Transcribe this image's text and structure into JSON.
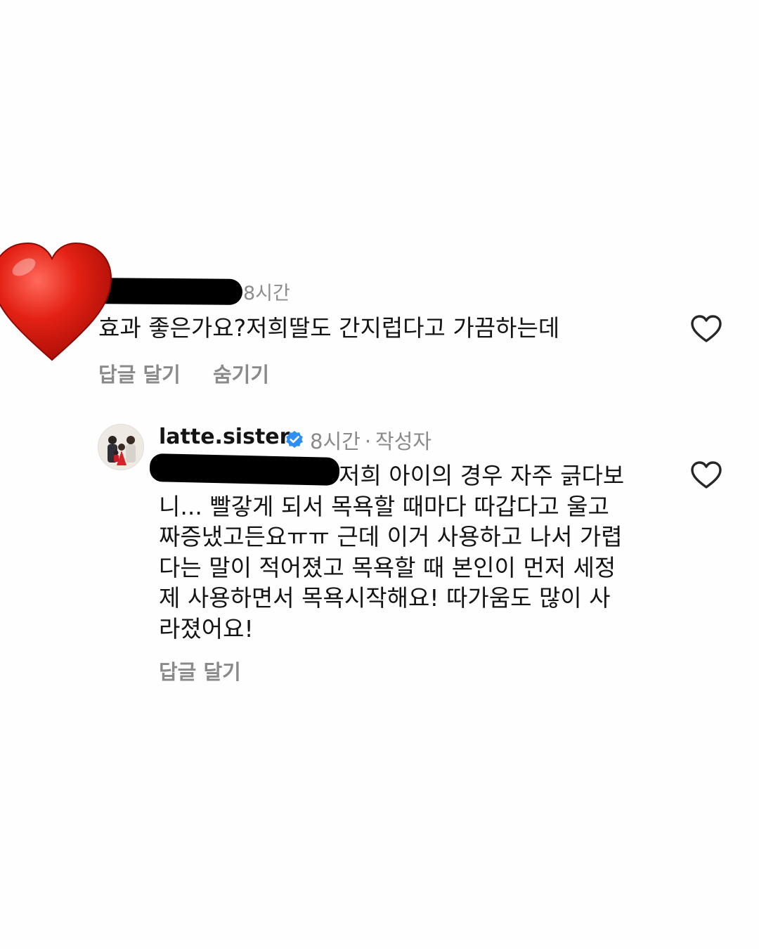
{
  "comment": {
    "time": "8시간",
    "text": "효과 좋은가요?저희딸도 간지럽다고 가끔하는데",
    "reply_label": "답글 달기",
    "hide_label": "숨기기"
  },
  "reply": {
    "username": "latte.sister",
    "time": "8시간",
    "separator": "·",
    "author_badge": "작성자",
    "lines": [
      "저희 아이의 경우 자주 긁다보",
      "니... 빨갛게 되서 목욕할 때마다 따갑다고 울고",
      "짜증냈고든요ㅠㅠ 근데 이거 사용하고 나서 가렵",
      "다는 말이 적어졌고 목욕할 때 본인이 먼저 세정",
      "제 사용하면서 목욕시작해요! 따가움도 많이 사",
      "라졌어요!"
    ],
    "reply_label": "답글 달기"
  },
  "icons": {
    "sticker": "red-heart-sticker",
    "like": "heart-outline-icon",
    "verified": "verified-badge-icon"
  },
  "colors": {
    "verified_blue": "#2f8ef4",
    "heart_red": "#e0231a",
    "muted_text": "#8a8a8a"
  }
}
